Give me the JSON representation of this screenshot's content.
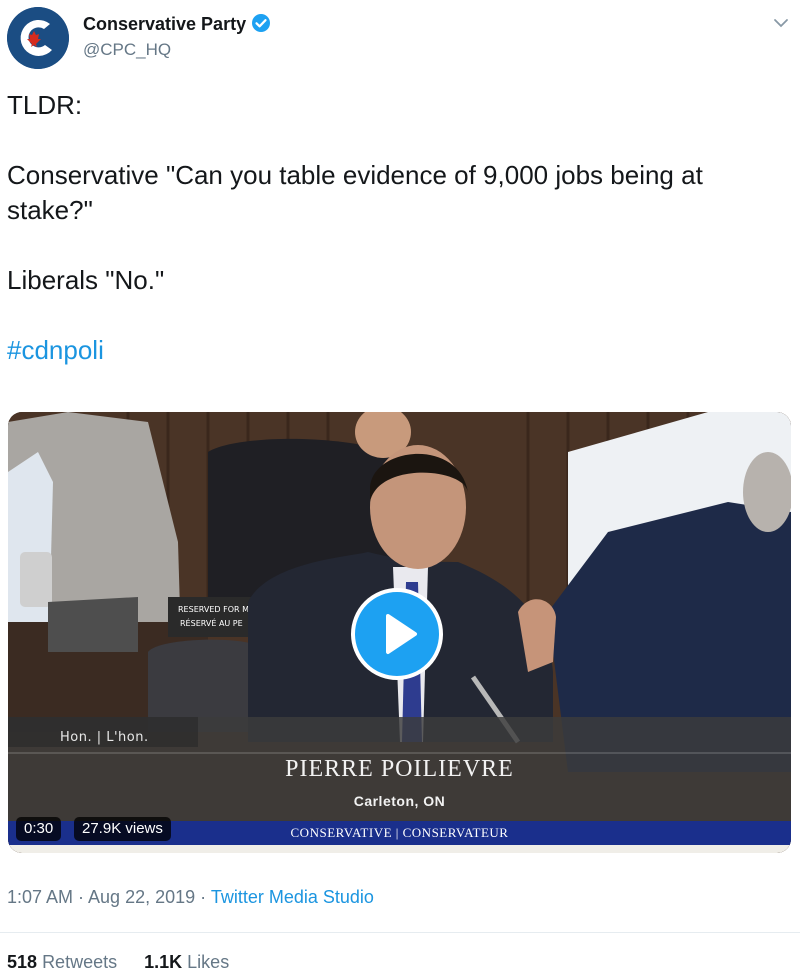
{
  "tweet": {
    "author_name": "Conservative Party",
    "author_handle": "@CPC_HQ",
    "verified": true,
    "icons": {
      "avatar": "conservative-party-logo",
      "verified": "verified-badge-icon",
      "menu": "chevron-down-icon",
      "play": "play-icon"
    },
    "text_lines": [
      "TLDR:",
      "Conservative \"Can you table evidence of 9,000 jobs being at stake?\"",
      "Liberals \"No.\""
    ],
    "hashtag": "#cdnpoli",
    "timestamp": "1:07 AM · Aug 22, 2019 · ",
    "source": "Twitter Media Studio",
    "retweets_count": "518",
    "retweets_label": "Retweets",
    "likes_count": "1.1K",
    "likes_label": "Likes"
  },
  "video": {
    "duration": "0:30",
    "views": "27.9K views",
    "placard": "RESERVED FOR MEM RÉSERVÉ AU PE",
    "lower_third_label": "Hon. | L'hon.",
    "speaker_name": "PIERRE POILIEVRE",
    "speaker_riding": "Carleton, ON",
    "party": "CONSERVATIVE | CONSERVATEUR"
  },
  "colors": {
    "link": "#1b95e0",
    "verified": "#1da1f2",
    "play_button": "#1da1f2",
    "party_bar": "#1a2f8c",
    "muted_text": "#657786"
  }
}
